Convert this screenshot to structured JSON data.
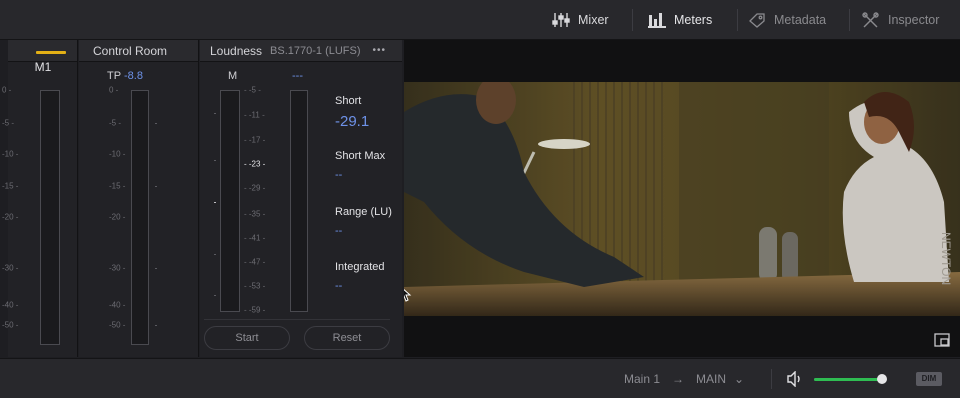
{
  "toolbar": {
    "mixer_label": "Mixer",
    "meters_label": "Meters",
    "metadata_label": "Metadata",
    "inspector_label": "Inspector"
  },
  "m1": {
    "title": "M1",
    "scale": [
      "0 -",
      "-5 -",
      "-10 -",
      "-15 -",
      "-20 -",
      "-30 -",
      "-40 -",
      "-50 -"
    ]
  },
  "control_room": {
    "title": "Control Room",
    "tp_label": "TP",
    "tp_value": "-8.8",
    "scale": [
      "0 -",
      "-5 -",
      "-10 -",
      "-15 -",
      "-20 -",
      "-30 -",
      "-40 -",
      "-50 -"
    ]
  },
  "loudness": {
    "title": "Loudness",
    "standard": "BS.1770-1 (LUFS)",
    "more": "•••",
    "m_label": "M",
    "m_value": "---",
    "scale": [
      "- -5 -",
      "- -11 -",
      "- -17 -",
      "- -23 -",
      "- -29 -",
      "- -35 -",
      "- -41 -",
      "- -47 -",
      "- -53 -",
      "- -59 -"
    ],
    "short_label": "Short",
    "short_value": "-29.1",
    "short_max_label": "Short Max",
    "short_max_value": "--",
    "range_label": "Range (LU)",
    "range_value": "--",
    "integrated_label": "Integrated",
    "integrated_value": "--",
    "start_label": "Start",
    "reset_label": "Reset"
  },
  "bottom": {
    "route_from": "Main 1",
    "arrow": "→",
    "route_to": "MAIN",
    "chevron": "⌄",
    "volume_level": 0.95,
    "dim_label": "DIM"
  },
  "overlay_text": "NEWTON",
  "colors": {
    "accent_blue": "#6e92e8",
    "m1_indicator": "#e3b016",
    "volume_green": "#2fbd52"
  }
}
